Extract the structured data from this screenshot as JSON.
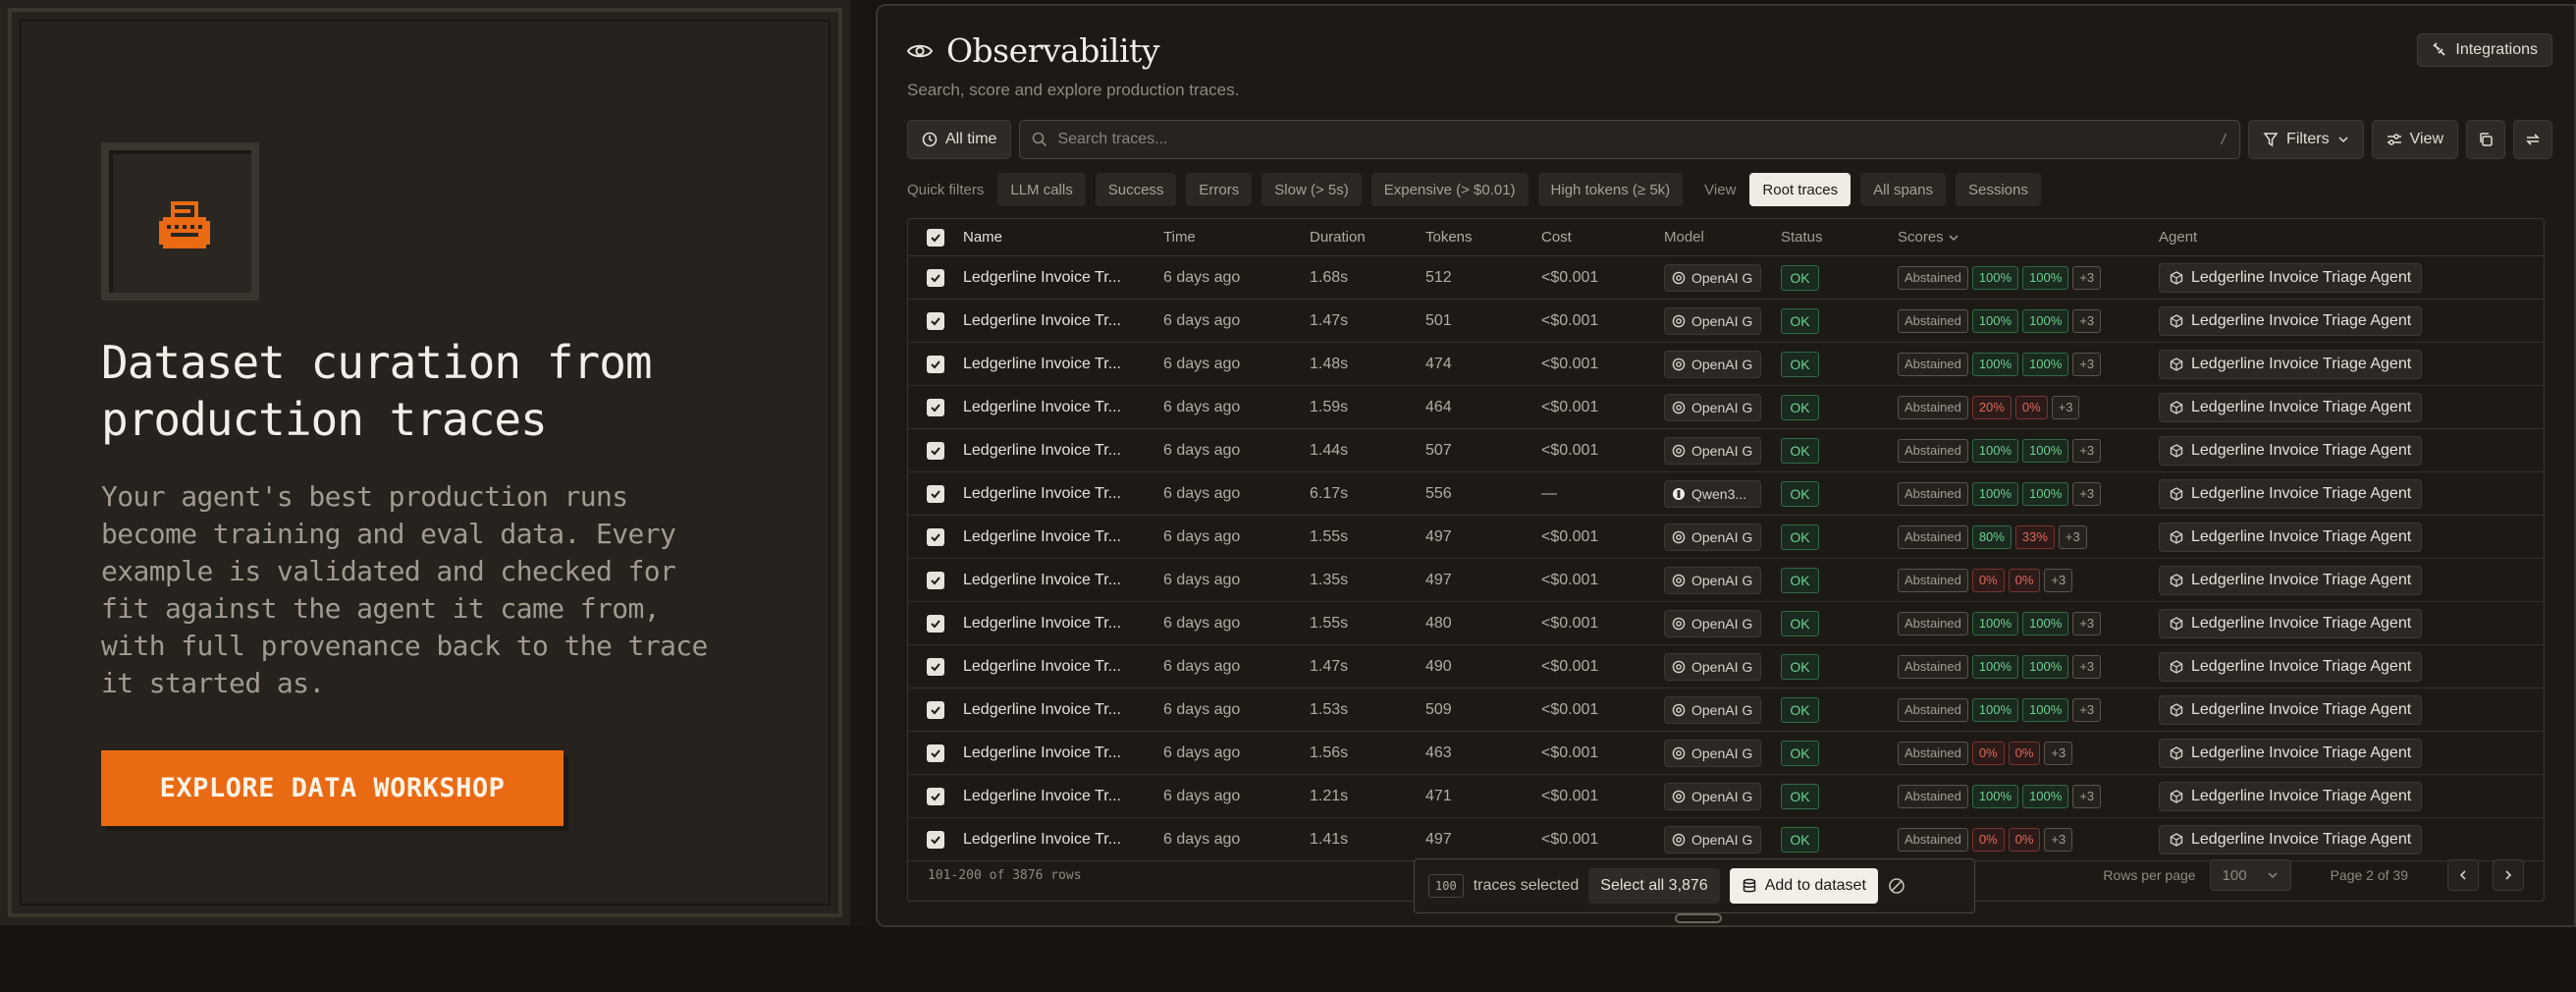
{
  "promo": {
    "title": "Dataset curation from production traces",
    "body": "Your agent's best production runs become training and eval data. Every example is validated and checked for fit against the agent it came from, with full provenance back to the trace it started as.",
    "cta": "EXPLORE DATA WORKSHOP",
    "accent": "#ea6a13"
  },
  "header": {
    "title": "Observability",
    "subtitle": "Search, score and explore production traces.",
    "integrations": "Integrations"
  },
  "toolbar": {
    "time_range": "All time",
    "search_placeholder": "Search traces...",
    "search_shortcut": "/",
    "filters": "Filters",
    "view": "View"
  },
  "quick_filters": {
    "label": "Quick filters",
    "items": [
      "LLM calls",
      "Success",
      "Errors",
      "Slow (> 5s)",
      "Expensive (> $0.01)",
      "High tokens (≥ 5k)"
    ],
    "view_label": "View",
    "views": [
      "Root traces",
      "All spans",
      "Sessions"
    ],
    "active_view": "Root traces"
  },
  "table": {
    "columns": [
      "Name",
      "Time",
      "Duration",
      "Tokens",
      "Cost",
      "Model",
      "Status",
      "Scores",
      "Agent"
    ],
    "rows": [
      {
        "name": "Ledgerline Invoice Tr...",
        "time": "6 days ago",
        "duration": "1.68s",
        "tokens": "512",
        "cost": "<$0.001",
        "model": "OpenAI G",
        "status": "OK",
        "scores": [
          [
            "Abstained",
            "abs"
          ],
          [
            "100%",
            "g"
          ],
          [
            "100%",
            "g"
          ],
          [
            "+3",
            "m"
          ]
        ],
        "agent": "Ledgerline Invoice Triage Agent"
      },
      {
        "name": "Ledgerline Invoice Tr...",
        "time": "6 days ago",
        "duration": "1.47s",
        "tokens": "501",
        "cost": "<$0.001",
        "model": "OpenAI G",
        "status": "OK",
        "scores": [
          [
            "Abstained",
            "abs"
          ],
          [
            "100%",
            "g"
          ],
          [
            "100%",
            "g"
          ],
          [
            "+3",
            "m"
          ]
        ],
        "agent": "Ledgerline Invoice Triage Agent"
      },
      {
        "name": "Ledgerline Invoice Tr...",
        "time": "6 days ago",
        "duration": "1.48s",
        "tokens": "474",
        "cost": "<$0.001",
        "model": "OpenAI G",
        "status": "OK",
        "scores": [
          [
            "Abstained",
            "abs"
          ],
          [
            "100%",
            "g"
          ],
          [
            "100%",
            "g"
          ],
          [
            "+3",
            "m"
          ]
        ],
        "agent": "Ledgerline Invoice Triage Agent"
      },
      {
        "name": "Ledgerline Invoice Tr...",
        "time": "6 days ago",
        "duration": "1.59s",
        "tokens": "464",
        "cost": "<$0.001",
        "model": "OpenAI G",
        "status": "OK",
        "scores": [
          [
            "Abstained",
            "abs"
          ],
          [
            "20%",
            "r"
          ],
          [
            "0%",
            "r"
          ],
          [
            "+3",
            "m"
          ]
        ],
        "agent": "Ledgerline Invoice Triage Agent"
      },
      {
        "name": "Ledgerline Invoice Tr...",
        "time": "6 days ago",
        "duration": "1.44s",
        "tokens": "507",
        "cost": "<$0.001",
        "model": "OpenAI G",
        "status": "OK",
        "scores": [
          [
            "Abstained",
            "abs"
          ],
          [
            "100%",
            "g"
          ],
          [
            "100%",
            "g"
          ],
          [
            "+3",
            "m"
          ]
        ],
        "agent": "Ledgerline Invoice Triage Agent"
      },
      {
        "name": "Ledgerline Invoice Tr...",
        "time": "6 days ago",
        "duration": "6.17s",
        "tokens": "556",
        "cost": "—",
        "model": "Qwen3...",
        "status": "OK",
        "scores": [
          [
            "Abstained",
            "abs"
          ],
          [
            "100%",
            "g"
          ],
          [
            "100%",
            "g"
          ],
          [
            "+3",
            "m"
          ]
        ],
        "agent": "Ledgerline Invoice Triage Agent"
      },
      {
        "name": "Ledgerline Invoice Tr...",
        "time": "6 days ago",
        "duration": "1.55s",
        "tokens": "497",
        "cost": "<$0.001",
        "model": "OpenAI G",
        "status": "OK",
        "scores": [
          [
            "Abstained",
            "abs"
          ],
          [
            "80%",
            "g"
          ],
          [
            "33%",
            "r"
          ],
          [
            "+3",
            "m"
          ]
        ],
        "agent": "Ledgerline Invoice Triage Agent"
      },
      {
        "name": "Ledgerline Invoice Tr...",
        "time": "6 days ago",
        "duration": "1.35s",
        "tokens": "497",
        "cost": "<$0.001",
        "model": "OpenAI G",
        "status": "OK",
        "scores": [
          [
            "Abstained",
            "abs"
          ],
          [
            "0%",
            "r"
          ],
          [
            "0%",
            "r"
          ],
          [
            "+3",
            "m"
          ]
        ],
        "agent": "Ledgerline Invoice Triage Agent"
      },
      {
        "name": "Ledgerline Invoice Tr...",
        "time": "6 days ago",
        "duration": "1.55s",
        "tokens": "480",
        "cost": "<$0.001",
        "model": "OpenAI G",
        "status": "OK",
        "scores": [
          [
            "Abstained",
            "abs"
          ],
          [
            "100%",
            "g"
          ],
          [
            "100%",
            "g"
          ],
          [
            "+3",
            "m"
          ]
        ],
        "agent": "Ledgerline Invoice Triage Agent"
      },
      {
        "name": "Ledgerline Invoice Tr...",
        "time": "6 days ago",
        "duration": "1.47s",
        "tokens": "490",
        "cost": "<$0.001",
        "model": "OpenAI G",
        "status": "OK",
        "scores": [
          [
            "Abstained",
            "abs"
          ],
          [
            "100%",
            "g"
          ],
          [
            "100%",
            "g"
          ],
          [
            "+3",
            "m"
          ]
        ],
        "agent": "Ledgerline Invoice Triage Agent"
      },
      {
        "name": "Ledgerline Invoice Tr...",
        "time": "6 days ago",
        "duration": "1.53s",
        "tokens": "509",
        "cost": "<$0.001",
        "model": "OpenAI G",
        "status": "OK",
        "scores": [
          [
            "Abstained",
            "abs"
          ],
          [
            "100%",
            "g"
          ],
          [
            "100%",
            "g"
          ],
          [
            "+3",
            "m"
          ]
        ],
        "agent": "Ledgerline Invoice Triage Agent"
      },
      {
        "name": "Ledgerline Invoice Tr...",
        "time": "6 days ago",
        "duration": "1.56s",
        "tokens": "463",
        "cost": "<$0.001",
        "model": "OpenAI G",
        "status": "OK",
        "scores": [
          [
            "Abstained",
            "abs"
          ],
          [
            "0%",
            "r"
          ],
          [
            "0%",
            "r"
          ],
          [
            "+3",
            "m"
          ]
        ],
        "agent": "Ledgerline Invoice Triage Agent"
      },
      {
        "name": "Ledgerline Invoice Tr...",
        "time": "6 days ago",
        "duration": "1.21s",
        "tokens": "471",
        "cost": "<$0.001",
        "model": "OpenAI G",
        "status": "OK",
        "scores": [
          [
            "Abstained",
            "abs"
          ],
          [
            "100%",
            "g"
          ],
          [
            "100%",
            "g"
          ],
          [
            "+3",
            "m"
          ]
        ],
        "agent": "Ledgerline Invoice Triage Agent"
      },
      {
        "name": "Ledgerline Invoice Tr...",
        "time": "6 days ago",
        "duration": "1.41s",
        "tokens": "497",
        "cost": "<$0.001",
        "model": "OpenAI G",
        "status": "OK",
        "scores": [
          [
            "Abstained",
            "abs"
          ],
          [
            "0%",
            "r"
          ],
          [
            "0%",
            "r"
          ],
          [
            "+3",
            "m"
          ]
        ],
        "agent": "Ledgerline Invoice Triage Agent"
      }
    ]
  },
  "footer": {
    "row_range": "101-200 of 3876 rows",
    "rows_per_page_label": "Rows per page",
    "rows_per_page": "100",
    "page": "Page 2 of 39"
  },
  "selection": {
    "count": "100",
    "label": "traces selected",
    "select_all": "Select all 3,876",
    "add": "Add to dataset"
  }
}
